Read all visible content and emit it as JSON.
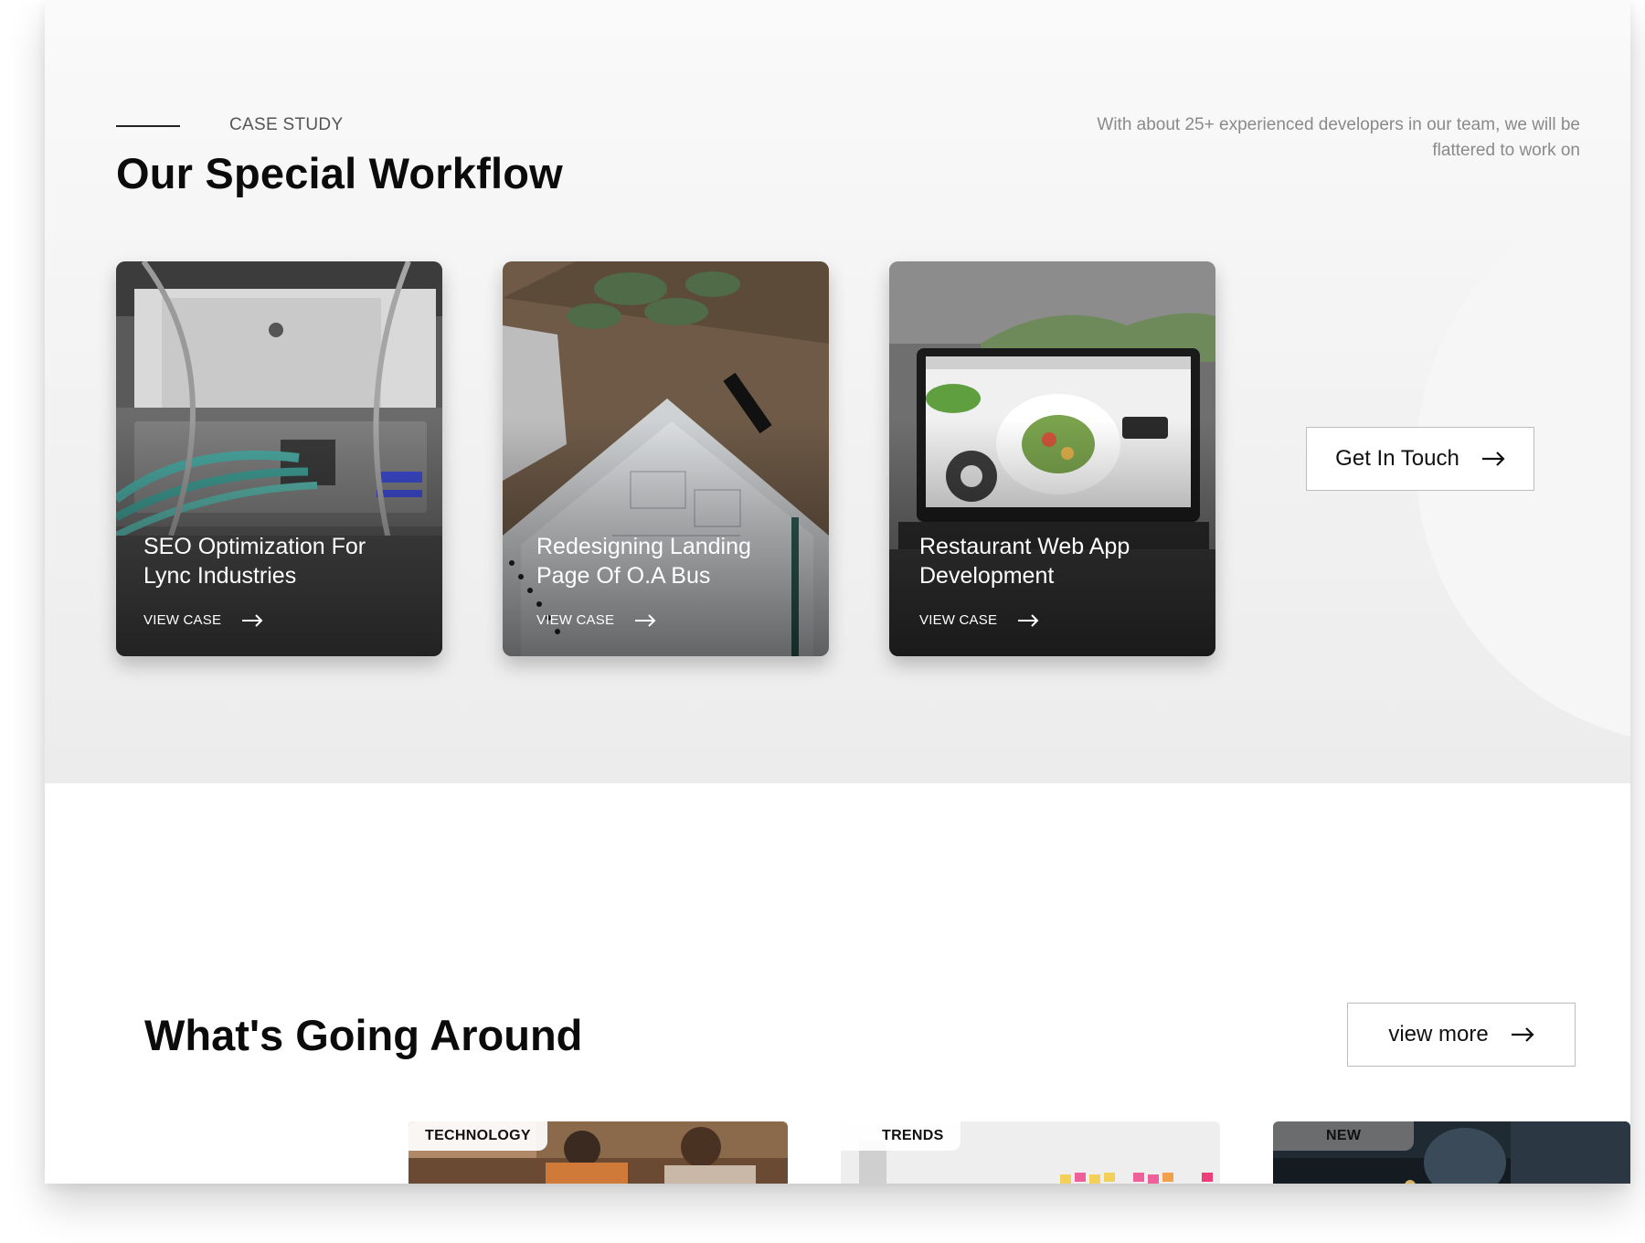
{
  "case_study": {
    "eyebrow": "CASE STUDY",
    "title": "Our Special Workflow",
    "intro": "With about  25+ experienced developers in our team, we will be flattered to work on",
    "cards": [
      {
        "title": "SEO Optimization For Lync Industries",
        "link": "VIEW CASE"
      },
      {
        "title": "Redesigning Landing Page Of O.A Bus",
        "link": "VIEW CASE"
      },
      {
        "title": "Restaurant Web App Development",
        "link": "VIEW CASE"
      }
    ],
    "cta": "Get In Touch"
  },
  "news": {
    "title": "What's Going Around",
    "view_more": "view more",
    "cards": [
      {
        "tag": "TECHNOLOGY"
      },
      {
        "tag": "TRENDS"
      },
      {
        "tag": "NEW"
      }
    ]
  },
  "colors": {
    "heading": "#0b0b0b",
    "muted_text": "#8a8a8a",
    "section_bg": "#f1f1f1",
    "button_border": "#bdbdbd"
  }
}
